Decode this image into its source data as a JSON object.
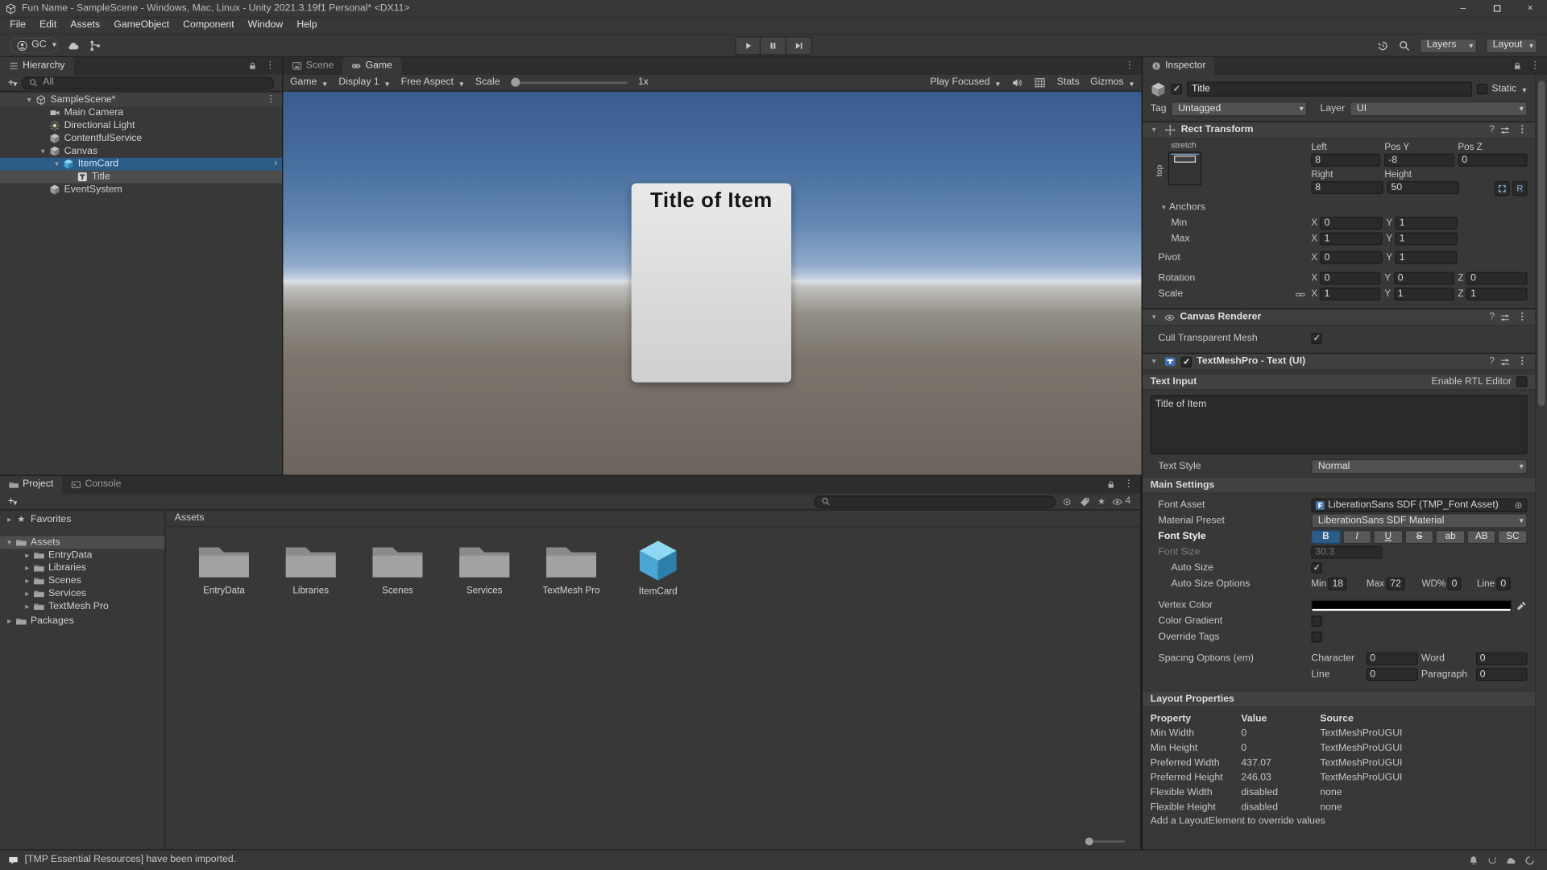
{
  "glyphs": {
    "kebab": "⋮",
    "plus": "+",
    "star": "★",
    "question": "?",
    "prefab_arrow": "›",
    "minimize": "–",
    "close": "×"
  },
  "window": {
    "title": "Fun Name - SampleScene - Windows, Mac, Linux - Unity 2021.3.19f1 Personal* <DX11>"
  },
  "menubar": {
    "items": [
      "File",
      "Edit",
      "Assets",
      "GameObject",
      "Component",
      "Window",
      "Help"
    ]
  },
  "toolbar": {
    "account": "GC",
    "layers": "Layers",
    "layout": "Layout"
  },
  "hierarchy": {
    "tab": "Hierarchy",
    "filter": "All",
    "scene": {
      "label": "SampleScene*"
    },
    "rows": [
      {
        "label": "Main Camera"
      },
      {
        "label": "Directional Light"
      },
      {
        "label": "ContentfulService"
      },
      {
        "label": "Canvas"
      },
      {
        "label": "ItemCard"
      },
      {
        "label": "Title"
      },
      {
        "label": "EventSystem"
      }
    ]
  },
  "viewport": {
    "tabs": {
      "scene": "Scene",
      "game": "Game"
    },
    "gamebar": {
      "mode": "Game",
      "display": "Display 1",
      "aspect": "Free Aspect",
      "scale_label": "Scale",
      "scale_value": "1x",
      "play_focused": "Play Focused",
      "stats": "Stats",
      "gizmos": "Gizmos"
    },
    "card": {
      "title": "Title of Item"
    }
  },
  "project": {
    "tabs": {
      "project": "Project",
      "console": "Console"
    },
    "favorites": "Favorites",
    "tree": {
      "assets": "Assets",
      "children": [
        "EntryData",
        "Libraries",
        "Scenes",
        "Services",
        "TextMesh Pro"
      ],
      "packages": "Packages"
    },
    "location": "Assets",
    "items": [
      {
        "label": "EntryData"
      },
      {
        "label": "Libraries"
      },
      {
        "label": "Scenes"
      },
      {
        "label": "Services"
      },
      {
        "label": "TextMesh Pro"
      },
      {
        "label": "ItemCard"
      }
    ],
    "hidden_count": "4"
  },
  "inspector": {
    "tab": "Inspector",
    "header": {
      "name": "Title",
      "static": "Static",
      "tag_label": "Tag",
      "tag": "Untagged",
      "layer_label": "Layer",
      "layer": "UI"
    },
    "rect": {
      "title": "Rect Transform",
      "anchor_h": "stretch",
      "anchor_v": "top",
      "col1_label": "Left",
      "col2_label": "Pos Y",
      "col3_label": "Pos Z",
      "col1": "8",
      "col2": "-8",
      "col3": "0",
      "col4_label": "Right",
      "col5_label": "Height",
      "col4": "8",
      "col5": "50",
      "raw_btn": "R",
      "anchors": "Anchors",
      "min_label": "Min",
      "min_x": "0",
      "min_y": "1",
      "max_label": "Max",
      "max_x": "1",
      "max_y": "1",
      "pivot_label": "Pivot",
      "pivot_x": "0",
      "pivot_y": "1",
      "rotation_label": "Rotation",
      "rot_x": "0",
      "rot_y": "0",
      "rot_z": "0",
      "scale_label": "Scale",
      "scale_x": "1",
      "scale_y": "1",
      "scale_z": "1",
      "x": "X",
      "y": "Y",
      "z": "Z"
    },
    "canvas_renderer": {
      "title": "Canvas Renderer",
      "cull": "Cull Transparent Mesh"
    },
    "tmp": {
      "title": "TextMeshPro - Text (UI)",
      "text_input": "Text Input",
      "rtl": "Enable RTL Editor",
      "text": "Title of Item",
      "text_style_label": "Text Style",
      "text_style": "Normal",
      "main_settings": "Main Settings",
      "font_asset_label": "Font Asset",
      "font_asset": "LiberationSans SDF (TMP_Font Asset)",
      "material_label": "Material Preset",
      "material": "LiberationSans SDF Material",
      "font_style_label": "Font Style",
      "styles": [
        "B",
        "I",
        "U",
        "S",
        "ab",
        "AB",
        "SC"
      ],
      "font_size_label": "Font Size",
      "font_size": "30.3",
      "auto_size_label": "Auto Size",
      "auto_opt_label": "Auto Size Options",
      "min_label": "Min",
      "min": "18",
      "max_label": "Max",
      "max": "72",
      "wd_label": "WD%",
      "wd": "0",
      "line_label": "Line",
      "line": "0",
      "vertex_label": "Vertex Color",
      "gradient_label": "Color Gradient",
      "override_label": "Override Tags",
      "spacing_label": "Spacing Options (em)",
      "char_label": "Character",
      "char": "0",
      "word_label": "Word",
      "word": "0",
      "sline_label": "Line",
      "sline": "0",
      "para_label": "Paragraph",
      "para": "0"
    },
    "layout_props": {
      "title": "Layout Properties",
      "col_property": "Property",
      "col_value": "Value",
      "col_source": "Source",
      "rows": [
        {
          "p": "Min Width",
          "v": "0",
          "s": "TextMeshProUGUI"
        },
        {
          "p": "Min Height",
          "v": "0",
          "s": "TextMeshProUGUI"
        },
        {
          "p": "Preferred Width",
          "v": "437.07",
          "s": "TextMeshProUGUI"
        },
        {
          "p": "Preferred Height",
          "v": "246.03",
          "s": "TextMeshProUGUI"
        },
        {
          "p": "Flexible Width",
          "v": "disabled",
          "s": "none"
        },
        {
          "p": "Flexible Height",
          "v": "disabled",
          "s": "none"
        }
      ],
      "footer": "Add a LayoutElement to override values"
    }
  },
  "statusbar": {
    "message": "[TMP Essential Resources] have been imported."
  }
}
